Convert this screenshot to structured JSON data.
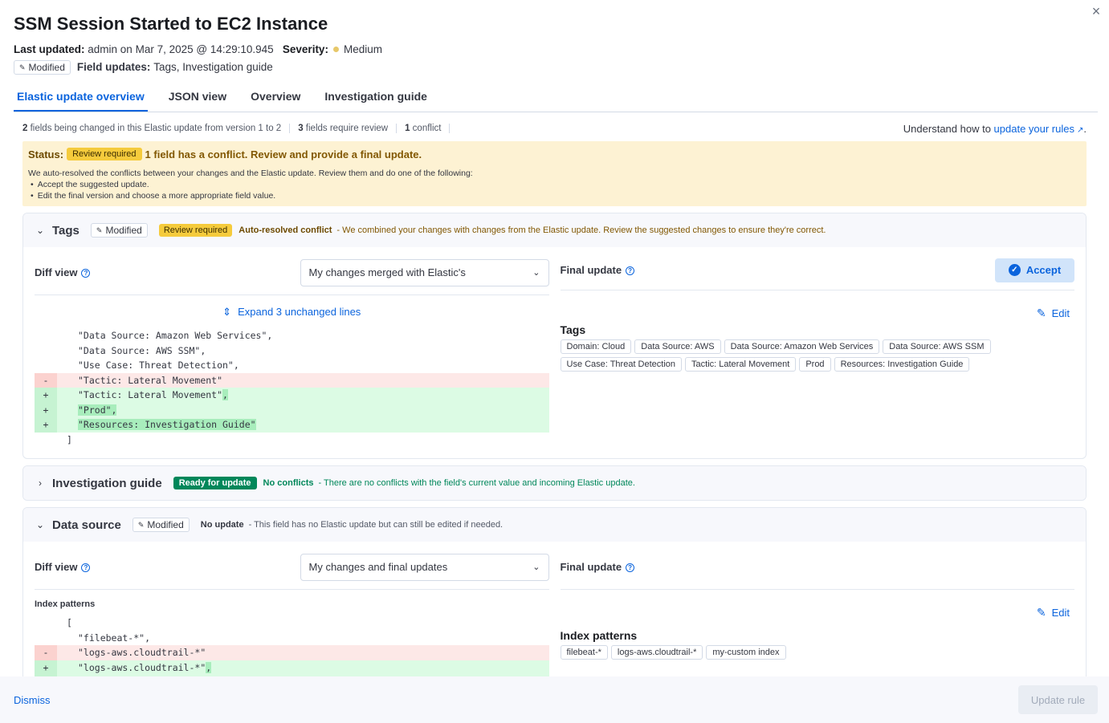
{
  "flyout": {
    "title": "SSM Session Started to EC2 Instance",
    "last_updated_label": "Last updated:",
    "last_updated_value": "admin on Mar 7, 2025 @ 14:29:10.945",
    "severity_label": "Severity:",
    "severity_value": "Medium",
    "modified_badge": "Modified",
    "field_updates_label": "Field updates:",
    "field_updates_value": "Tags, Investigation guide",
    "close_label": "×"
  },
  "tabs": [
    {
      "label": "Elastic update overview",
      "active": true
    },
    {
      "label": "JSON view",
      "active": false
    },
    {
      "label": "Overview",
      "active": false
    },
    {
      "label": "Investigation guide",
      "active": false
    }
  ],
  "stats": {
    "changed_count": "2",
    "changed_text": " fields being changed in this Elastic update from version 1 to 2",
    "review_count": "3",
    "review_text": " fields require review",
    "conflict_count": "1",
    "conflict_text": " conflict",
    "rules_prefix": "Understand how to ",
    "rules_link": "update your rules",
    "rules_suffix": "."
  },
  "status": {
    "label": "Status:",
    "badge": "Review required",
    "message": "1 field has a conflict. Review and provide a final update.",
    "body": "We auto-resolved the conflicts between your changes and the Elastic update. Review them and do one of the following:",
    "bullets": [
      "Accept the suggested update.",
      "Edit the final version and choose a more appropriate field value."
    ]
  },
  "tags_section": {
    "title": "Tags",
    "modified_badge": "Modified",
    "review_badge": "Review required",
    "conflict_label": "Auto-resolved conflict",
    "conflict_desc": "- We combined your changes with changes from the Elastic update. Review the suggested changes to ensure they're correct.",
    "diff_view_label": "Diff view",
    "diff_select_value": "My changes merged with Elastic's",
    "expand_text": "Expand 3 unchanged lines",
    "final_update_label": "Final update",
    "accept_label": "Accept",
    "edit_label": "Edit",
    "value_title": "Tags",
    "chips": [
      "Domain: Cloud",
      "Data Source: AWS",
      "Data Source: Amazon Web Services",
      "Data Source: AWS SSM",
      "Use Case: Threat Detection",
      "Tactic: Lateral Movement",
      "Prod",
      "Resources: Investigation Guide"
    ],
    "code_lines": [
      {
        "type": "ctx",
        "gutter": "",
        "text": "\"Data Source: Amazon Web Services\","
      },
      {
        "type": "ctx",
        "gutter": "",
        "text": "\"Data Source: AWS SSM\","
      },
      {
        "type": "ctx",
        "gutter": "",
        "text": "\"Use Case: Threat Detection\","
      },
      {
        "type": "del",
        "gutter": "-",
        "text": "\"Tactic: Lateral Movement\""
      },
      {
        "type": "add",
        "gutter": "+",
        "text": "\"Tactic: Lateral Movement\"",
        "hl": ","
      },
      {
        "type": "add",
        "gutter": "+",
        "text": "",
        "hl": "\"Prod\","
      },
      {
        "type": "add",
        "gutter": "+",
        "text": "",
        "hl": "\"Resources: Investigation Guide\""
      },
      {
        "type": "ctx",
        "gutter": "",
        "text": "]",
        "outdent": true
      }
    ]
  },
  "guide_section": {
    "title": "Investigation guide",
    "ready_badge": "Ready for update",
    "noconf_label": "No conflicts",
    "noconf_desc": "- There are no conflicts with the field's current value and incoming Elastic update."
  },
  "datasource_section": {
    "title": "Data source",
    "modified_badge": "Modified",
    "noupdate_label": "No update",
    "noupdate_desc": "- This field has no Elastic update but can still be edited if needed.",
    "diff_view_label": "Diff view",
    "diff_select_value": "My changes and final updates",
    "final_update_label": "Final update",
    "edit_label": "Edit",
    "sub_label": "Index patterns",
    "value_title": "Index patterns",
    "chips": [
      "filebeat-*",
      "logs-aws.cloudtrail-*",
      "my-custom index"
    ],
    "code_lines": [
      {
        "type": "ctx",
        "gutter": "",
        "text": "[",
        "outdent": true
      },
      {
        "type": "ctx",
        "gutter": "",
        "text": "\"filebeat-*\","
      },
      {
        "type": "del",
        "gutter": "-",
        "text": "\"logs-aws.cloudtrail-*\""
      },
      {
        "type": "add",
        "gutter": "+",
        "text": "\"logs-aws.cloudtrail-*\"",
        "hl": ","
      },
      {
        "type": "add",
        "gutter": "+",
        "text": "",
        "hl": "\"my-custom index\"",
        "outdent": true
      }
    ]
  },
  "footer": {
    "dismiss_label": "Dismiss",
    "update_label": "Update rule"
  }
}
